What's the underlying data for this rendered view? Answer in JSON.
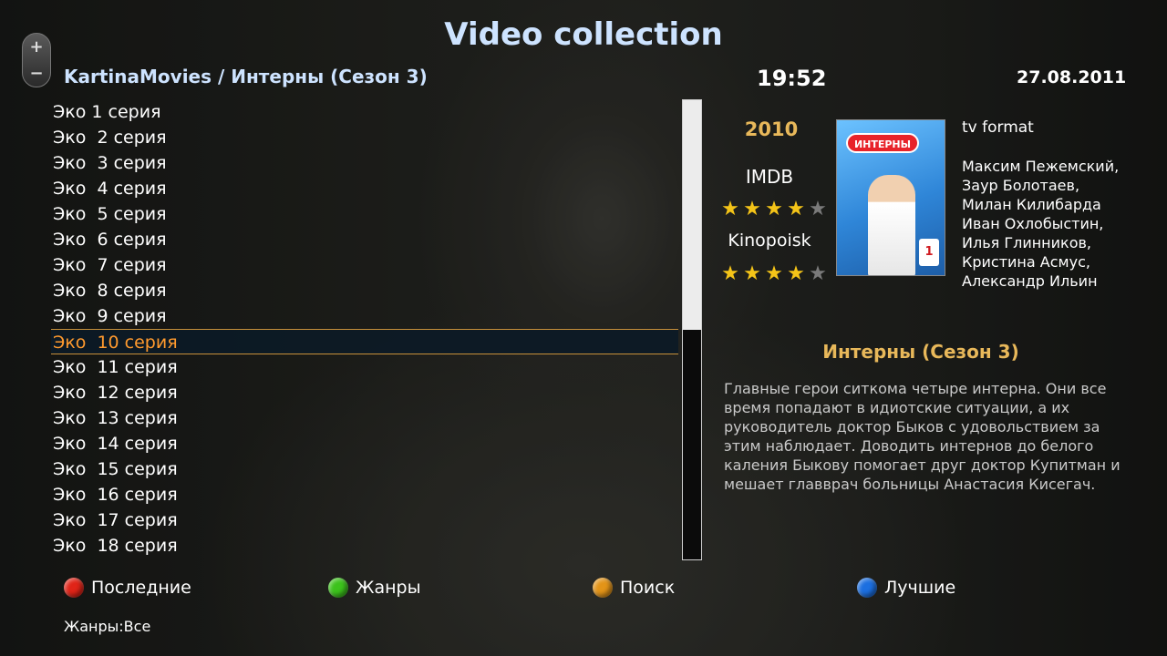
{
  "header": {
    "title": "Video collection",
    "path": "KartinaMovies / Интерны  (Сезон 3)",
    "time": "19:52",
    "date": "27.08.2011"
  },
  "remote": {
    "plus": "+",
    "minus": "−"
  },
  "episodes": [
    "Эко 1 серия",
    "Эко  2 серия",
    "Эко  3 серия",
    "Эко  4 серия",
    "Эко  5 серия",
    "Эко  6 серия",
    "Эко  7 серия",
    "Эко  8 серия",
    "Эко  9 серия",
    "Эко  10 серия",
    "Эко  11 серия",
    "Эко  12 серия",
    "Эко  13 серия",
    "Эко  14 серия",
    "Эко  15 серия",
    "Эко  16 серия",
    "Эко  17 серия",
    "Эко  18 серия"
  ],
  "selected_index": 9,
  "scroll_position": 0.5,
  "info": {
    "year": "2010",
    "imdb_label": "IMDB",
    "imdb_rating": 4,
    "kinopoisk_label": "Kinopoisk",
    "kinopoisk_rating": 4,
    "rating_max": 5,
    "format": "tv format",
    "cast": "Максим Пежемский, Заур Болотаев, Милан Килибарда Иван Охлобыстин, Илья Глинников, Кристина Асмус, Александр Ильин",
    "poster_banner": "ИНТЕРНЫ",
    "poster_badge": "1",
    "description_title": "Интерны  (Сезон 3)",
    "description": "Главные герои ситкома  четыре интерна. Они все время попадают в идиотские ситуации, а их руководитель доктор Быков с удовольствием за этим наблюдает. Доводить интернов до белого каления Быкову помогает друг доктор Купитман и мешает главврач больницы Анастасия Кисегач."
  },
  "buttons": {
    "red": {
      "label": "Последние",
      "color": "#e02418"
    },
    "green": {
      "label": "Жанры",
      "color": "#3cc21c"
    },
    "yellow": {
      "label": "Поиск",
      "color": "#e39418"
    },
    "blue": {
      "label": "Лучшие",
      "color": "#1c6fe0"
    }
  },
  "status": {
    "genres": "Жанры:Все"
  },
  "colors": {
    "title": "#cde3ff",
    "accent_gold": "#e8b85a",
    "selection_text": "#ff9a2e"
  }
}
